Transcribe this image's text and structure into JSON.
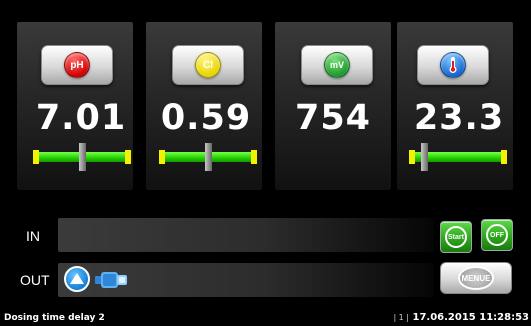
{
  "measurements": [
    {
      "icon": "ph-icon",
      "badge": "pH",
      "value": "7.01",
      "has_gauge": true,
      "gauge_position": 0.5
    },
    {
      "icon": "chlorine-icon",
      "badge": "Cl",
      "value": "0.59",
      "has_gauge": true,
      "gauge_position": 0.5
    },
    {
      "icon": "redox-mv-icon",
      "badge": "mV",
      "value": "754",
      "has_gauge": false
    },
    {
      "icon": "thermometer-icon",
      "badge": "",
      "value": "23.3",
      "has_gauge": true,
      "gauge_position": 0.15
    }
  ],
  "io": {
    "in_label": "IN",
    "out_label": "OUT"
  },
  "controls": {
    "start_label": "Start",
    "off_label": "OFF",
    "menu_label": "MENUE"
  },
  "status": {
    "message": "Dosing time delay 2",
    "page": "| 1 |",
    "datetime": "17.06.2015 11:28:53"
  },
  "colors": {
    "ph": "#d00000",
    "chlorine": "#e8d400",
    "redox": "#1f9a2e",
    "temperature": "#1466d0",
    "gauge_green": "#26d400",
    "gauge_yellow": "#f2f200"
  }
}
